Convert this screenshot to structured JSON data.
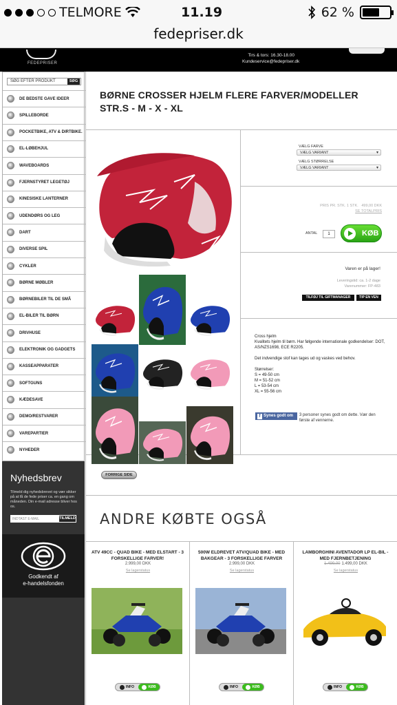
{
  "status_bar": {
    "carrier": "TELMORE",
    "time": "11.19",
    "battery": "62 %",
    "battery_level": 0.62
  },
  "browser": {
    "url": "fedepriser.dk"
  },
  "header": {
    "logo_text": "FEDEPRISER",
    "hours": "Tirs & tors: 16.30-18.00",
    "email": "Kundeservice@fedepriser.dk"
  },
  "sidebar": {
    "search_placeholder": "SØG EFTER PRODUKT",
    "search_button": "SØG",
    "categories": [
      "DE BEDSTE GAVE IDEER",
      "SPILLEBORDE",
      "POCKETBIKE, ATV & DIRTBIKE.",
      "EL-LØBEHJUL",
      "WAVEBOARDS",
      "FJERNSTYRET LEGETØJ",
      "KINESISKE LANTERNER",
      "UDENDØRS OG LEG",
      "DART",
      "DIVERSE SPIL",
      "CYKLER",
      "BØRNE MØBLER",
      "BØRNEBILER TIL DE SMÅ",
      "EL-BILER TIL BØRN",
      "DRIVHUSE",
      "ELEKTRONIK OG GADGETS",
      "KASSEAPPARATER",
      "SOFTGUNS",
      "KÆDESAVE",
      "DEMO/RESTVARER",
      "VAREPARTIER",
      "NYHEDER"
    ],
    "newsletter": {
      "title": "Nyhedsbrev",
      "text": "Tilmeld dig nyhedsbrevet og vær sikker på at få de fede priser ca. en gang om måneden. Din e-mail adresse bliver hos os.",
      "input_placeholder": "INDTAST E-MAIL",
      "button": "TILMELD"
    },
    "ehandel": {
      "line1": "Godkendt af",
      "line2": "e-handelsfonden"
    }
  },
  "product": {
    "title": "BØRNE CROSSER HJELM FLERE FARVER/MODELLER STR.S - M - X - XL",
    "choose_color_label": "VÆLG FARVE",
    "choose_color_value": "VÆLG VARIANT",
    "choose_size_label": "VÆLG STØRRELSE",
    "choose_size_value": "VÆLG VARIANT",
    "price_label": "PRIS PR. STK. 1 STK.",
    "price": "499,00 DKK",
    "total_link": "SE TOTALPRIS",
    "qty_label": "ANTAL",
    "qty": "1",
    "buy_button": "KØB",
    "stock": "Varen er på lager!",
    "delivery": "Leveringstid: ca. 1-2 dage",
    "item_number": "Varenummer: FP-483",
    "giftmanager_button": "TILFØJ TIL GIFTMANAGER",
    "tip_button": "TIP EN VEN",
    "description": [
      "Cross hjelm",
      "Kvalitets hjelm til børn. Har følgende internationale godkendelser: DOT, AS/NZS1698, ECE R2205.",
      "",
      "Det indvendige stof kan tages ud og vaskes ved behov.",
      "",
      "Størrelser:",
      "S = 49-50 cm",
      "M = 51-52 cm",
      "L = 53-54 cm",
      "XL = 55-56 cm"
    ],
    "fb_button": "Synes godt om",
    "fb_text": "3 personer synes godt om dette. Vær den første af vennerne.",
    "prev_button": "FORRIGE SIDE"
  },
  "also_bought": {
    "title": "ANDRE KØBTE OGSÅ",
    "items": [
      {
        "name": "ATV 49CC - QUAD BIKE - MED ELSTART - 3 FORSKELLIGE FARVER!",
        "old_price": "",
        "price": "2.999,00 DKK",
        "stock": "Se lagerstatus",
        "info": "INFO",
        "buy": "KØB"
      },
      {
        "name": "500W ELDREVET ATV/QUAD BIKE - MED BAKGEAR - 3 FORSKELLIGE FARVER",
        "old_price": "",
        "price": "2.999,00 DKK",
        "stock": "Se lagerstatus",
        "info": "INFO",
        "buy": "KØB"
      },
      {
        "name": "LAMBORGHINI AVENTADOR LP EL-BIL - MED FJERNBETJENING",
        "old_price": "1.499,00",
        "price": "1.499,00 DKK",
        "stock": "Se lagerstatus",
        "info": "INFO",
        "buy": "KØB"
      }
    ]
  },
  "colors": {
    "accent_green": "#3bbb1d",
    "dark": "#333333",
    "helmet_red": "#c2233a",
    "helmet_blue": "#2040b0",
    "helmet_pink": "#f29ab8"
  }
}
